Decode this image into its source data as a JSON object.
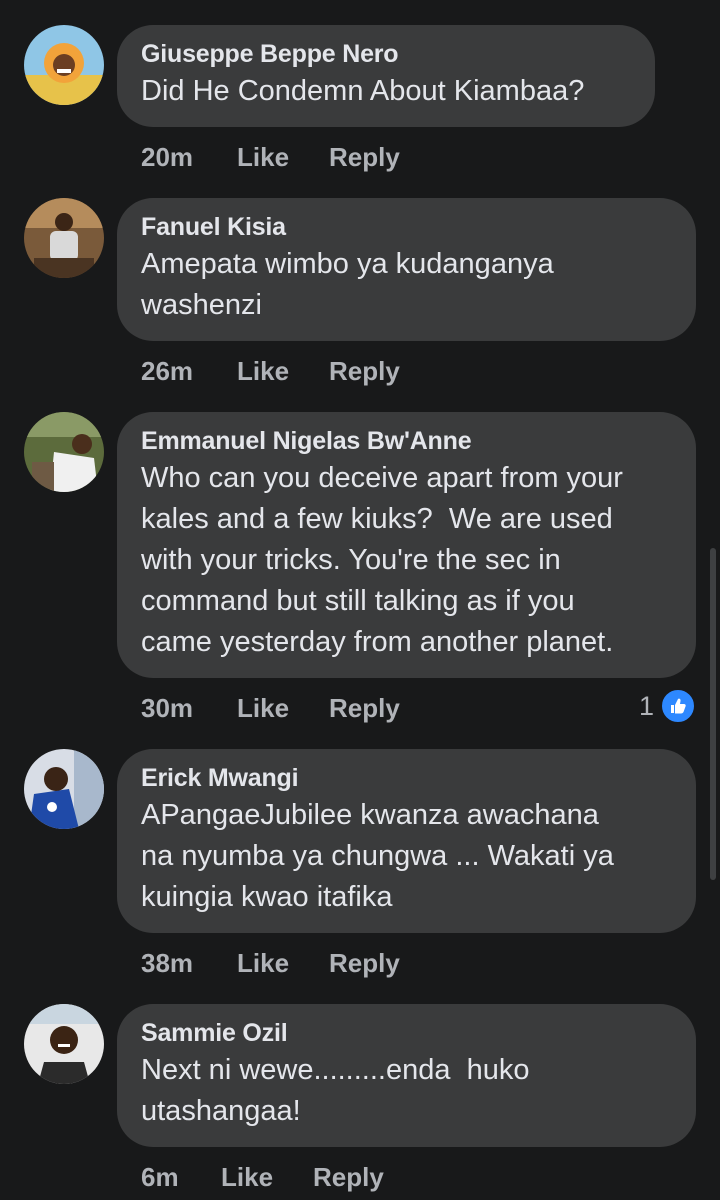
{
  "comments": [
    {
      "author": "Giuseppe Beppe Nero",
      "text": "Did He Condemn About Kiambaa?",
      "time": "20m",
      "like_label": "Like",
      "reply_label": "Reply"
    },
    {
      "author": "Fanuel Kisia",
      "text": "Amepata wimbo ya kudanganya\nwashenzi",
      "time": "26m",
      "like_label": "Like",
      "reply_label": "Reply"
    },
    {
      "author": "Emmanuel Nigelas Bw'Anne",
      "text": "Who can you deceive apart from your\nkales and a few kiuks?  We are used\nwith your tricks. You're the sec in\ncommand but still talking as if you\ncame yesterday from another planet.",
      "time": "30m",
      "like_label": "Like",
      "reply_label": "Reply",
      "reaction_count": "1"
    },
    {
      "author": "Erick Mwangi",
      "text": "APangaeJubilee kwanza awachana\nna nyumba ya chungwa ... Wakati ya\nkuingia kwao itafika",
      "time": "38m",
      "like_label": "Like",
      "reply_label": "Reply"
    },
    {
      "author": "Sammie Ozil",
      "text": "Next ni wewe.........enda  huko\nutashangaa!",
      "time": "6m",
      "like_label": "Like",
      "reply_label": "Reply"
    }
  ],
  "colors": {
    "background": "#18191a",
    "bubble": "#3a3b3c",
    "text": "#e4e6eb",
    "meta": "#b0b3b8",
    "like_badge": "#2d88ff"
  },
  "icons": {
    "reaction": "thumbs-up-icon"
  }
}
